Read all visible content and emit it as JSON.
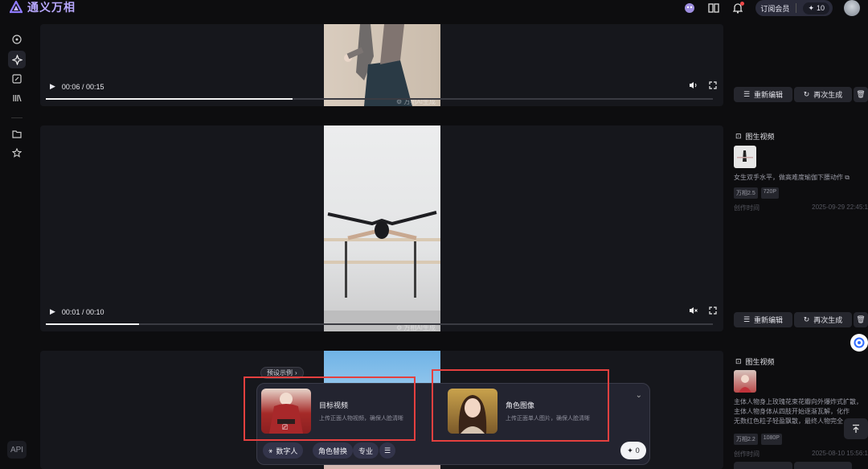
{
  "app": {
    "title": "通义万相"
  },
  "header": {
    "subscribe_label": "订阅会员",
    "credits": "10"
  },
  "sidebar": {
    "api_label": "API"
  },
  "cards": [
    {
      "time": "00:06 / 00:15",
      "progress": 0.37,
      "watermark": "万相AI生成",
      "retry": "重新编辑",
      "regen": "再次生成"
    },
    {
      "time": "00:01 / 00:10",
      "progress": 0.14,
      "watermark": "万相AI生成",
      "retry": "重新编辑",
      "regen": "再次生成"
    }
  ],
  "details": [
    {
      "type_label": "图生视频",
      "desc": "女生双手水平，做高难度瑜伽下腰动作",
      "tags": [
        "万相2.5",
        "720P"
      ],
      "created_label": "创作时间",
      "created_at": "2025-09-29 22:45:1"
    },
    {
      "type_label": "图生视频",
      "desc_lines": [
        "主体人物身上玫瑰花束花瓣向外爆炸式扩散，",
        "主体人物身体从四肢开始逐渐瓦解，化作",
        "无数红色粒子轻盈飘散，最终人物完全"
      ],
      "tags": [
        "万相2.2",
        "1080P"
      ],
      "created_label": "创作时间",
      "created_at": "2025-08-10 15:56:1"
    }
  ],
  "composer": {
    "preset_label": "预设示例",
    "slot1": {
      "title": "目标视频",
      "subtitle": "上传正面人物视频，确保人脸清晰"
    },
    "slot2": {
      "title": "角色图像",
      "subtitle": "上传正面单人图片，确保人脸清晰"
    },
    "chips": [
      "数字人",
      "角色替换",
      "专业"
    ],
    "generate_count": "0"
  },
  "colors": {
    "accent": "#b9a9ff",
    "highlight_box": "#e5403f",
    "background": "#0d0d0f"
  }
}
